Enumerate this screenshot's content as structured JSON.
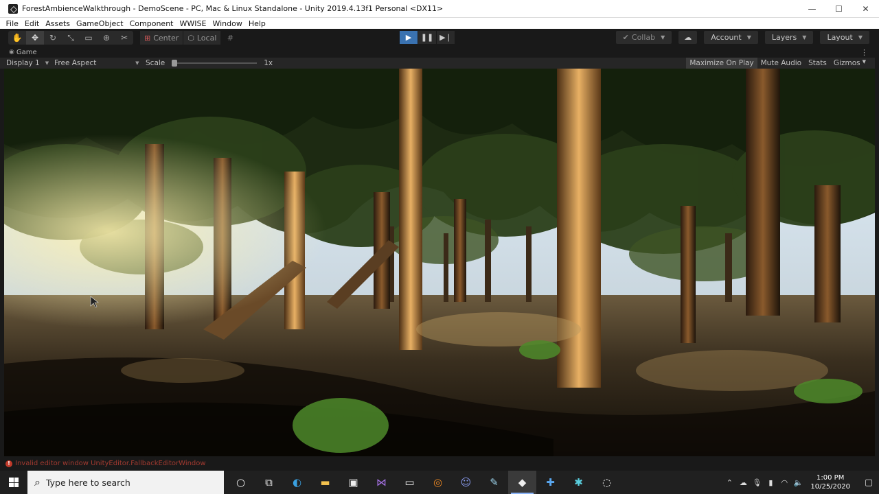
{
  "window": {
    "title": "ForestAmbienceWalkthrough - DemoScene - PC, Mac & Linux Standalone - Unity 2019.4.13f1 Personal <DX11>",
    "controls": {
      "minimize": "—",
      "maximize": "☐",
      "close": "✕"
    }
  },
  "menu": [
    "File",
    "Edit",
    "Assets",
    "GameObject",
    "Component",
    "WWISE",
    "Window",
    "Help"
  ],
  "toolbar": {
    "transform_tools": [
      "hand-tool",
      "move-tool",
      "rotate-tool",
      "scale-tool",
      "rect-tool",
      "transform-tool",
      "custom-tool"
    ],
    "pivot_mode": "Center",
    "pivot_rotation": "Local",
    "collab": "Collab",
    "account": "Account",
    "layers": "Layers",
    "layout": "Layout"
  },
  "game_tab": {
    "label": "Game"
  },
  "game_toolbar": {
    "display": "Display 1",
    "aspect": "Free Aspect",
    "scale_label": "Scale",
    "scale_value": "1x",
    "scale_fraction": 0,
    "maximize_on_play": "Maximize On Play",
    "mute_audio": "Mute Audio",
    "stats": "Stats",
    "gizmos": "Gizmos"
  },
  "status": {
    "message": "Invalid editor window UnityEditor.FallbackEditorWindow",
    "level": "error"
  },
  "taskbar": {
    "search_placeholder": "Type here to search",
    "apps": [
      "cortana-icon",
      "task-view-icon",
      "edge-icon",
      "file-explorer-icon",
      "store-icon",
      "visual-studio-icon",
      "terminal-icon",
      "blender-icon",
      "discord-icon",
      "notepad-icon",
      "unity-icon",
      "app-icon-blue",
      "app-icon-teal",
      "obs-icon"
    ],
    "time": "1:00 PM",
    "date": "10/25/2020"
  },
  "colors": {
    "editor_bg": "#191919",
    "panel_bg": "#262626",
    "play_active": "#3a72b0",
    "error_red": "#c23a2a",
    "taskbar_bg": "#202020"
  }
}
